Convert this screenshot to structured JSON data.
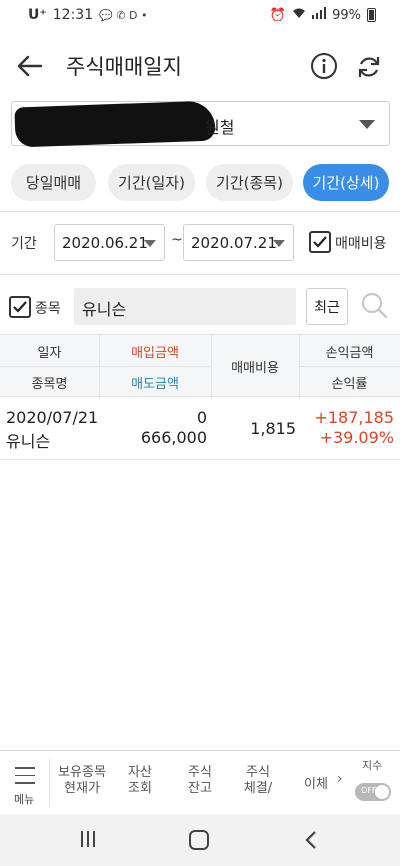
{
  "status_bar": {
    "carrier": "U⁺",
    "time": "12:31",
    "indicators": "💬 ✆ D •",
    "battery_percent": "99%"
  },
  "header": {
    "title": "주식매매일지",
    "icons": [
      "back-arrow-icon",
      "info-icon",
      "refresh-icon"
    ]
  },
  "account": {
    "name_visible": "원철"
  },
  "tabs": [
    {
      "label": "당일매매",
      "active": false
    },
    {
      "label": "기간(일자)",
      "active": false
    },
    {
      "label": "기간(종목)",
      "active": false
    },
    {
      "label": "기간(상세)",
      "active": true
    }
  ],
  "period": {
    "label": "기간",
    "start_date": "2020.06.21",
    "separator": "~",
    "end_date": "2020.07.21",
    "fee_checkbox_label": "매매비용",
    "fee_checked": true
  },
  "stock_filter": {
    "label": "종목",
    "checked": true,
    "value": "유니슨",
    "recent_label": "최근"
  },
  "table": {
    "headers": {
      "date": "일자",
      "name": "종목명",
      "buy_amount": "매입금액",
      "sell_amount": "매도금액",
      "fee": "매매비용",
      "pnl_amount": "손익금액",
      "pnl_rate": "손익률"
    },
    "rows": [
      {
        "date": "2020/07/21",
        "name": "유니슨",
        "buy_amount": "0",
        "sell_amount": "666,000",
        "fee": "1,815",
        "pnl_amount": "+187,185",
        "pnl_rate": "+39.09%"
      }
    ]
  },
  "bottom_nav": {
    "menu_label": "메뉴",
    "items": [
      {
        "line1": "보유종목",
        "line2": "현재가"
      },
      {
        "line1": "자산",
        "line2": "조회"
      },
      {
        "line1": "주식",
        "line2": "잔고"
      },
      {
        "line1": "주식",
        "line2": "체결/"
      }
    ],
    "more": "이체",
    "index_label": "지수",
    "toggle_label": "OFF"
  },
  "colors": {
    "accent_blue": "#3b8ee8",
    "profit_red": "#d9452b",
    "buy_header_red": "#d24832",
    "sell_header_blue": "#2f7fa8"
  }
}
